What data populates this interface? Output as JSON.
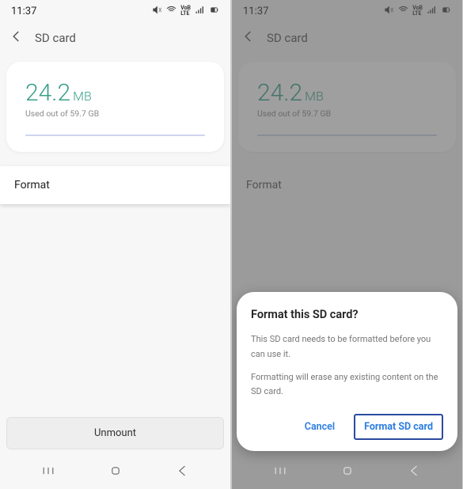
{
  "status": {
    "time": "11:37"
  },
  "header": {
    "title": "SD card"
  },
  "usage": {
    "amount": "24.2",
    "unit": "MB",
    "subtitle": "Used out of 59.7 GB"
  },
  "actions": {
    "format_label": "Format",
    "unmount_label": "Unmount"
  },
  "dialog": {
    "title": "Format this SD card?",
    "line1": "This SD card needs to be formatted before you can use it.",
    "line2": "Formatting will erase any existing content on the SD card.",
    "cancel": "Cancel",
    "confirm": "Format SD card"
  }
}
